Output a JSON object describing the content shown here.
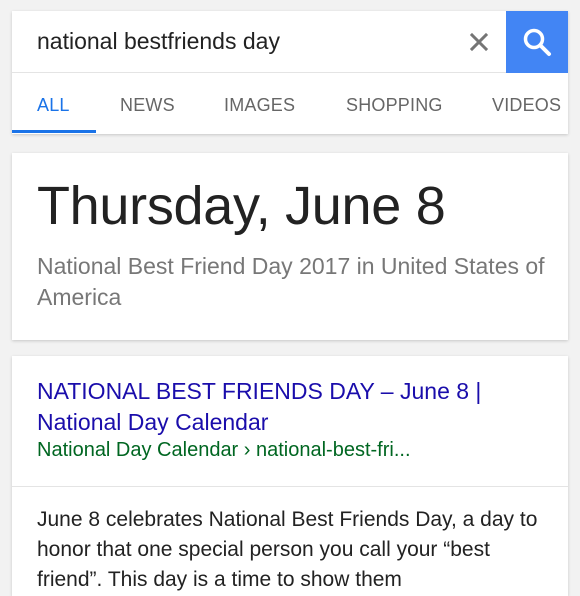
{
  "search": {
    "query": "national bestfriends day",
    "clear_icon": "close-icon",
    "search_icon": "search-icon"
  },
  "tabs": [
    {
      "label": "ALL",
      "active": true
    },
    {
      "label": "NEWS",
      "active": false
    },
    {
      "label": "IMAGES",
      "active": false
    },
    {
      "label": "SHOPPING",
      "active": false
    },
    {
      "label": "VIDEOS",
      "active": false
    }
  ],
  "answer": {
    "title": "Thursday, June 8",
    "subtitle": "National Best Friend Day 2017 in United States of America"
  },
  "result": {
    "title": "NATIONAL BEST FRIENDS DAY – June 8 | National Day Calendar",
    "url": "National Day Calendar › national-best-fri...",
    "snippet": "June 8 celebrates National Best Friends Day, a day to honor that one special person you call your “best friend”. This day is a time to show them"
  },
  "colors": {
    "accent": "#4285f4",
    "tab_active": "#1a73e8",
    "link": "#1a0dab",
    "url": "#006621"
  }
}
